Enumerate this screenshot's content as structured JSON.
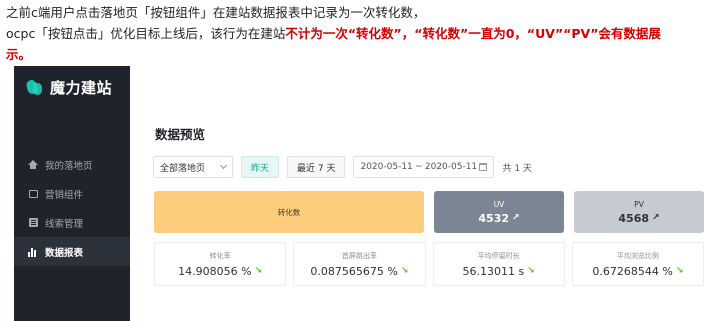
{
  "note": {
    "line1": "之前c端用户点击落地页「按钮组件」在建站数据报表中记录为一次转化数，",
    "line2_prefix": "ocpc「按钮点击」优化目标上线后，该行为在建站",
    "line2_highlight": "不计为一次“转化数”，“转化数”一直为0，“UV”“PV”会有数据展",
    "line3_highlight": "示。"
  },
  "app": {
    "logo_text": "魔力建站",
    "nav": [
      {
        "label": "我的落地页",
        "icon": "home-icon",
        "active": false
      },
      {
        "label": "营销组件",
        "icon": "component-icon",
        "active": false
      },
      {
        "label": "线索管理",
        "icon": "clue-icon",
        "active": false
      },
      {
        "label": "数据报表",
        "icon": "bar-chart-icon",
        "active": true
      }
    ]
  },
  "main": {
    "title": "数据预览",
    "filter": {
      "page_select": "全部落地页",
      "yesterday": "昨天",
      "last7": "最近 7 天",
      "date_start": "2020-05-11",
      "date_sep": "~",
      "date_end": "2020-05-11",
      "days": "共 1 天"
    },
    "cards": {
      "conversion_label": "转化数",
      "uv_label": "UV",
      "uv_value": "4532",
      "pv_label": "PV",
      "pv_value": "4568"
    },
    "metrics": [
      {
        "label": "转化率",
        "value": "14.908056 %"
      },
      {
        "label": "首屏跳出率",
        "value": "0.087565675 %"
      },
      {
        "label": "平均停留时长",
        "value": "56.13011 s"
      },
      {
        "label": "平均浏览比例",
        "value": "0.67268544 %"
      }
    ]
  },
  "colors": {
    "sidebar_bg": "#1f242c",
    "conversion_card": "#fdcd7e",
    "uv_card": "#7c8594",
    "pv_card": "#c6cad3",
    "highlight_text": "#d40000",
    "trend_up": "#52c41a"
  }
}
